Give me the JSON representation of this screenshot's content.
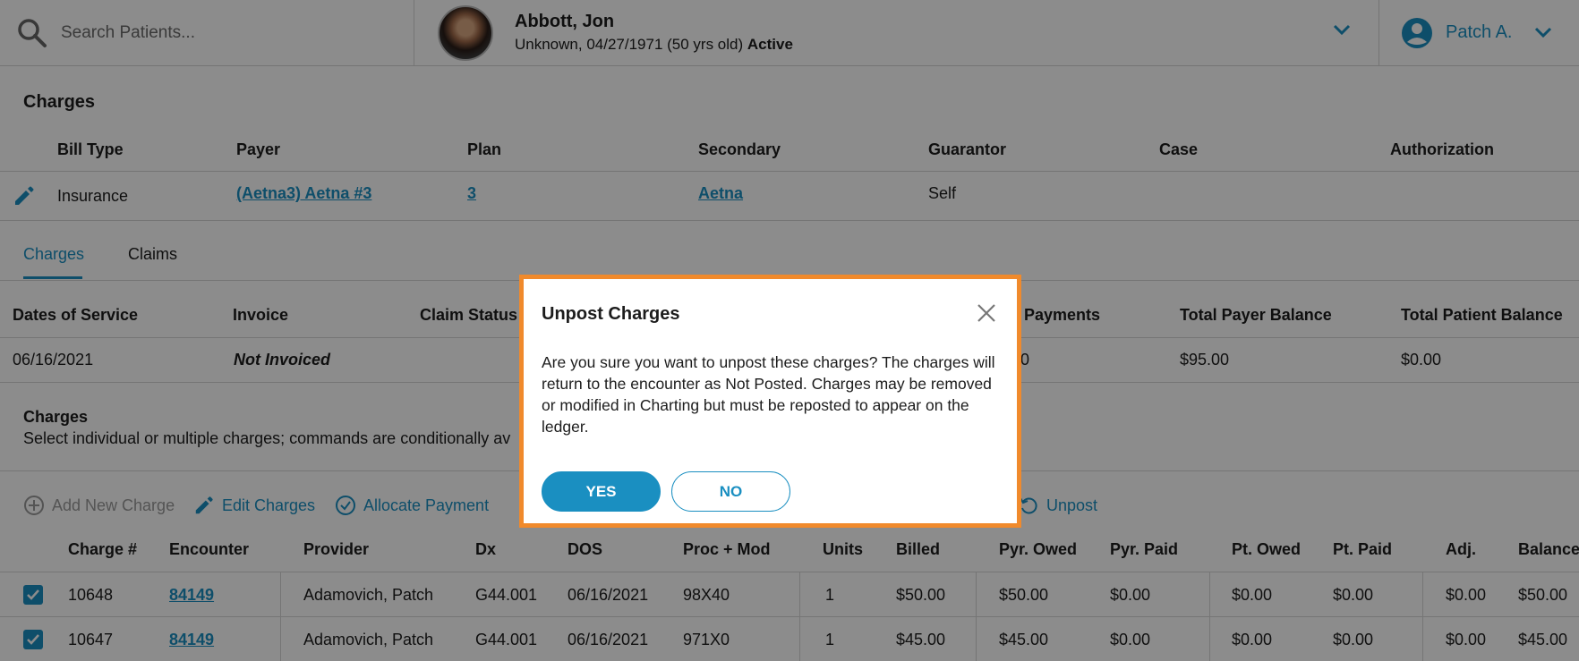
{
  "search": {
    "placeholder": "Search Patients..."
  },
  "patient": {
    "name": "Abbott, Jon",
    "details": "Unknown, 04/27/1971 (50 yrs old)",
    "status": "Active"
  },
  "user": {
    "name": "Patch A."
  },
  "charges_section": {
    "title": "Charges",
    "headers": [
      "Bill Type",
      "Payer",
      "Plan",
      "Secondary",
      "Guarantor",
      "Case",
      "Authorization"
    ],
    "row": {
      "bill_type": "Insurance",
      "payer": "(Aetna3) Aetna #3",
      "plan": "3",
      "secondary": "Aetna",
      "guarantor": "Self"
    }
  },
  "tabs": [
    {
      "label": "Charges",
      "active": true
    },
    {
      "label": "Claims",
      "active": false
    }
  ],
  "invoice_table": {
    "headers": [
      "Dates of Service",
      "Invoice",
      "Claim Status",
      "al Payments",
      "Total Payer Balance",
      "Total Patient Balance"
    ],
    "row": {
      "dos": "06/16/2021",
      "invoice": "Not Invoiced",
      "payments_partial": "00",
      "payer_balance": "$95.00",
      "patient_balance": "$0.00"
    }
  },
  "charges_list": {
    "title": "Charges",
    "subtitle": "Select individual or multiple charges; commands are conditionally av"
  },
  "toolbar": {
    "add_new_charge": "Add New Charge",
    "edit_charges": "Edit Charges",
    "allocate_payment": "Allocate Payment",
    "unpost": "Unpost"
  },
  "line_items": {
    "headers": [
      "Charge #",
      "Encounter",
      "Provider",
      "Dx",
      "DOS",
      "Proc + Mod",
      "Units",
      "Billed",
      "Pyr. Owed",
      "Pyr. Paid",
      "Pt. Owed",
      "Pt. Paid",
      "Adj.",
      "Balance"
    ],
    "rows": [
      [
        "10648",
        "84149",
        "Adamovich, Patch",
        "G44.001",
        "06/16/2021",
        "98X40",
        "1",
        "$50.00",
        "$50.00",
        "$0.00",
        "$0.00",
        "$0.00",
        "$0.00",
        "$50.00"
      ],
      [
        "10647",
        "84149",
        "Adamovich, Patch",
        "G44.001",
        "06/16/2021",
        "971X0",
        "1",
        "$45.00",
        "$45.00",
        "$0.00",
        "$0.00",
        "$0.00",
        "$0.00",
        "$45.00"
      ]
    ]
  },
  "modal": {
    "title": "Unpost Charges",
    "body": "Are you sure you want to unpost these charges? The charges will return to the encounter as Not Posted. Charges may be removed or modified in Charting but must be reposted to appear on the ledger.",
    "yes": "YES",
    "no": "NO"
  },
  "colors": {
    "accent": "#1a8fc1",
    "modal_border": "#f08a2c"
  }
}
